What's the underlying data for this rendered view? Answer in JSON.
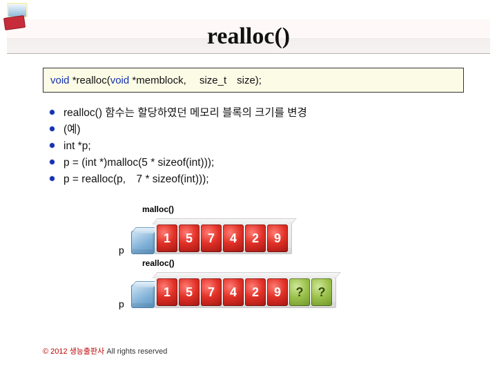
{
  "title": "realloc()",
  "signature": {
    "pre_kw": "",
    "kw1": "void",
    "mid1": " *realloc(",
    "kw2": "void",
    "mid2": " *memblock,　 size_t　size);"
  },
  "bullets": [
    "realloc() 함수는 할당하였던 메모리 블록의 크기를 변경",
    "(예)",
    "int *p;",
    "p = (int *)malloc(5 * sizeof(int)));",
    "p = realloc(p,　7 * sizeof(int)));"
  ],
  "diagram": {
    "label_malloc": "malloc()",
    "label_realloc": "realloc()",
    "pointer_label": "p",
    "row1": [
      {
        "text": "1",
        "kind": "red"
      },
      {
        "text": "5",
        "kind": "red"
      },
      {
        "text": "7",
        "kind": "red"
      },
      {
        "text": "4",
        "kind": "red"
      },
      {
        "text": "2",
        "kind": "red"
      },
      {
        "text": "9",
        "kind": "red"
      }
    ],
    "row2": [
      {
        "text": "1",
        "kind": "red"
      },
      {
        "text": "5",
        "kind": "red"
      },
      {
        "text": "7",
        "kind": "red"
      },
      {
        "text": "4",
        "kind": "red"
      },
      {
        "text": "2",
        "kind": "red"
      },
      {
        "text": "9",
        "kind": "red"
      },
      {
        "text": "?",
        "kind": "green"
      },
      {
        "text": "?",
        "kind": "green"
      }
    ]
  },
  "footer": {
    "copy": "© 2012 생능출판사",
    "rights": " All rights reserved"
  }
}
